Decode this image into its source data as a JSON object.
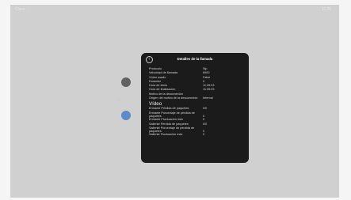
{
  "topbar": {
    "site_name": "Cisco",
    "time": "11:26"
  },
  "modal": {
    "title": "Detalles de la llamada",
    "rows": [
      {
        "label": "Protocolo",
        "value": "Sip"
      },
      {
        "label": "Velocidad de llamada",
        "value": "6000"
      },
      {
        "label": "Vídeo usado",
        "value": "False"
      },
      {
        "label": "Duración",
        "value": "0"
      },
      {
        "label": "Hora de inicio",
        "value": "11:26:03"
      },
      {
        "label": "Hora de finalización",
        "value": "11:26:03"
      },
      {
        "label": "Motivo de la desconexión",
        "value": ""
      },
      {
        "label": "Origen del motivo de la desconexión",
        "value": "Internal"
      }
    ],
    "video_section": {
      "title": "Vídeo",
      "rows": [
        {
          "label": "Entrante Pérdida de paquetes",
          "value": "0/0"
        },
        {
          "label": "Entrante Porcentaje de pérdida de paquetes",
          "value": "0"
        },
        {
          "label": "Entrante Fluctuación máx",
          "value": "0"
        },
        {
          "label": "Saliente Pérdida de paquetes",
          "value": "0/0"
        },
        {
          "label": "Saliente Porcentaje de pérdida de paquetes",
          "value": "0"
        },
        {
          "label": "Saliente Fluctuación máx",
          "value": "0"
        }
      ]
    }
  }
}
